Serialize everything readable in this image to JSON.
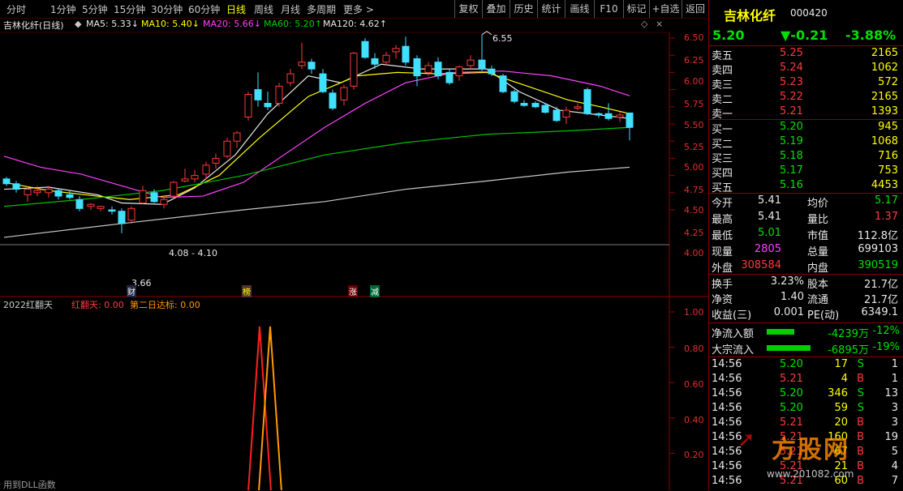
{
  "tabs": [
    "分时",
    "1分钟",
    "5分钟",
    "15分钟",
    "30分钟",
    "60分钟",
    "日线",
    "周线",
    "月线",
    "多周期",
    "更多 >"
  ],
  "active_tab": "日线",
  "toolbar": [
    "复权",
    "叠加",
    "历史",
    "统计",
    "画线",
    "F10",
    "标记",
    "+自选",
    "返回"
  ],
  "chart_title": "吉林化纤(日线)",
  "ma": {
    "ma5": "MA5: 5.33↓",
    "ma10": "MA10: 5.40↓",
    "ma20": "MA20: 5.66↓",
    "ma60": "MA60: 5.20↑",
    "ma120": "MA120: 4.62↑"
  },
  "price_axis": [
    "6.50",
    "6.25",
    "6.00",
    "5.75",
    "5.50",
    "5.25",
    "5.00",
    "4.75",
    "4.50",
    "4.25",
    "4.00"
  ],
  "annotations": {
    "high": "6.55",
    "low": "3.66",
    "range": "4.08 - 4.10"
  },
  "markers": [
    "财",
    "榜",
    "涨",
    "减"
  ],
  "indicator": {
    "name": "2022红翻天",
    "v1": "红翻天: 0.00",
    "v2": "第二日达标: 0.00",
    "axis": [
      "1.00",
      "0.80",
      "0.60",
      "0.40",
      "0.20"
    ],
    "footer": "用到DLL函数"
  },
  "stock": {
    "name": "吉林化纤",
    "code": "000420",
    "price": "5.20",
    "change": "▼-0.21",
    "pct": "-3.88%"
  },
  "asks": [
    {
      "label": "卖五",
      "price": "5.25",
      "vol": "2165"
    },
    {
      "label": "卖四",
      "price": "5.24",
      "vol": "1062"
    },
    {
      "label": "卖三",
      "price": "5.23",
      "vol": "572"
    },
    {
      "label": "卖二",
      "price": "5.22",
      "vol": "2165"
    },
    {
      "label": "卖一",
      "price": "5.21",
      "vol": "1393"
    }
  ],
  "bids": [
    {
      "label": "买一",
      "price": "5.20",
      "vol": "945"
    },
    {
      "label": "买二",
      "price": "5.19",
      "vol": "1068"
    },
    {
      "label": "买三",
      "price": "5.18",
      "vol": "716"
    },
    {
      "label": "买四",
      "price": "5.17",
      "vol": "753"
    },
    {
      "label": "买五",
      "price": "5.16",
      "vol": "4453"
    }
  ],
  "stats": [
    {
      "l1": "今开",
      "v1": "5.41",
      "l2": "均价",
      "v2": "5.17"
    },
    {
      "l1": "最高",
      "v1": "5.41",
      "l2": "量比",
      "v2": "1.37"
    },
    {
      "l1": "最低",
      "v1": "5.01",
      "l2": "市值",
      "v2": "112.8亿"
    },
    {
      "l1": "现量",
      "v1": "2805",
      "l2": "总量",
      "v2": "699103"
    },
    {
      "l1": "外盘",
      "v1": "308584",
      "l2": "内盘",
      "v2": "390519"
    }
  ],
  "stats2": [
    {
      "l1": "换手",
      "v1": "3.23%",
      "l2": "股本",
      "v2": "21.7亿"
    },
    {
      "l1": "净资",
      "v1": "1.40",
      "l2": "流通",
      "v2": "21.7亿"
    },
    {
      "l1": "收益(三)",
      "v1": "0.001",
      "l2": "PE(动)",
      "v2": "6349.1"
    }
  ],
  "flows": [
    {
      "label": "净流入额",
      "value": "-4239万",
      "pct": "-12%"
    },
    {
      "label": "大宗流入",
      "value": "-6895万",
      "pct": "-19%"
    }
  ],
  "ticks": [
    {
      "t": "14:56",
      "p": "5.20",
      "v": "17",
      "s": "S",
      "n": "1"
    },
    {
      "t": "14:56",
      "p": "5.21",
      "v": "4",
      "s": "B",
      "n": "1"
    },
    {
      "t": "14:56",
      "p": "5.20",
      "v": "346",
      "s": "S",
      "n": "13"
    },
    {
      "t": "14:56",
      "p": "5.20",
      "v": "59",
      "s": "S",
      "n": "3"
    },
    {
      "t": "14:56",
      "p": "5.21",
      "v": "20",
      "s": "B",
      "n": "3"
    },
    {
      "t": "14:56",
      "p": "5.21",
      "v": "160",
      "s": "B",
      "n": "19"
    },
    {
      "t": "14:56",
      "p": "5.21",
      "v": "67",
      "s": "B",
      "n": "5"
    },
    {
      "t": "14:56",
      "p": "5.21",
      "v": "21",
      "s": "B",
      "n": "4"
    },
    {
      "t": "14:56",
      "p": "5.21",
      "v": "60",
      "s": "B",
      "n": "7"
    }
  ],
  "watermark": {
    "text": "方股网",
    "url": "www.201082.com"
  },
  "colors": {
    "up": "#ff3a3a",
    "down": "#40e0ff",
    "ma5": "#e8e8e8",
    "ma10": "#ffff00",
    "ma20": "#ff40ff",
    "ma60": "#00c000",
    "ma120": "#c8c8c8"
  }
}
